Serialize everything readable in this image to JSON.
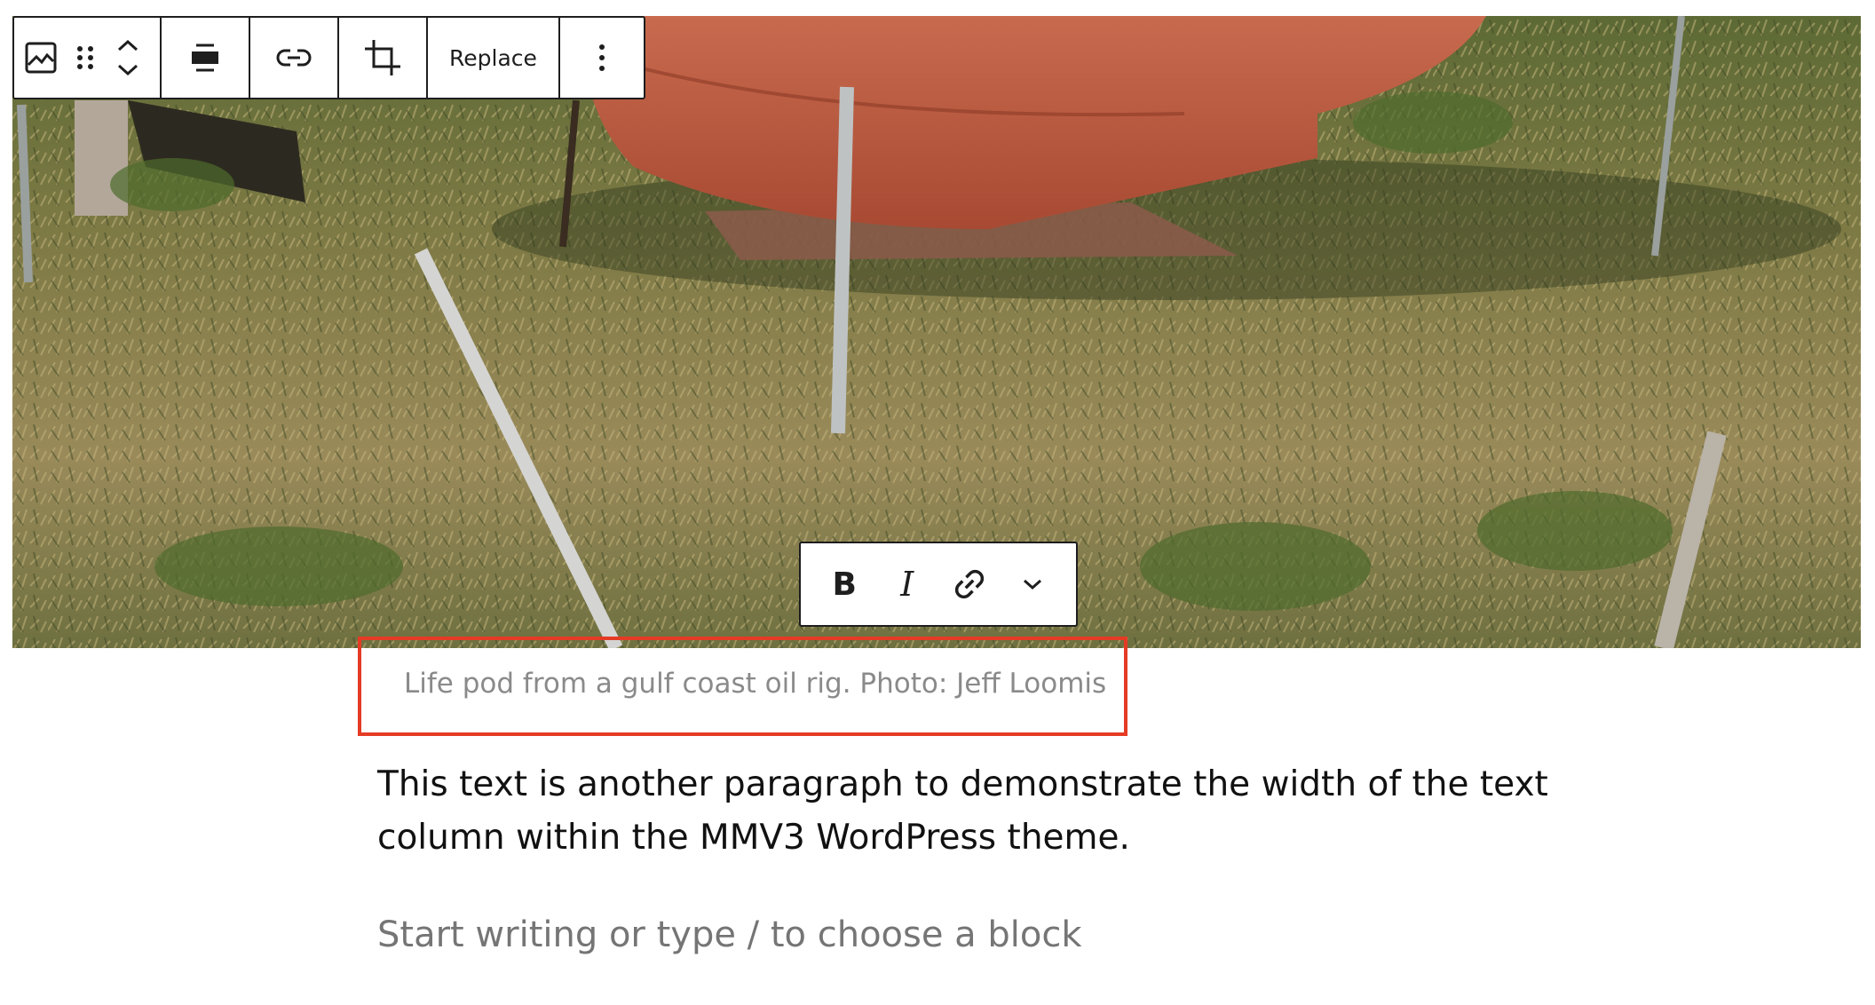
{
  "image_block": {
    "alt_description": "",
    "toolbar": {
      "replace_label": "Replace",
      "icons": [
        "image-icon",
        "drag-handle-icon",
        "chevron-up-icon",
        "chevron-down-icon",
        "align-center-icon",
        "link-icon",
        "crop-icon",
        "more-options-icon"
      ]
    },
    "caption": "Life pod from a gulf coast oil rig. Photo: Jeff Loomis",
    "format_toolbar": {
      "bold_label": "B",
      "italic_label": "I",
      "icons": [
        "link-icon",
        "chevron-down-icon"
      ]
    }
  },
  "content": {
    "paragraph": "This text is another paragraph to demonstrate the width of the text column within the MMV3 WordPress theme.",
    "placeholder": "Start writing or type / to choose a block"
  },
  "colors": {
    "selection_outline": "#e53b25",
    "toolbar_border": "#1e1e1e",
    "caption_text": "#8a8a8a",
    "placeholder_text": "#757575"
  }
}
